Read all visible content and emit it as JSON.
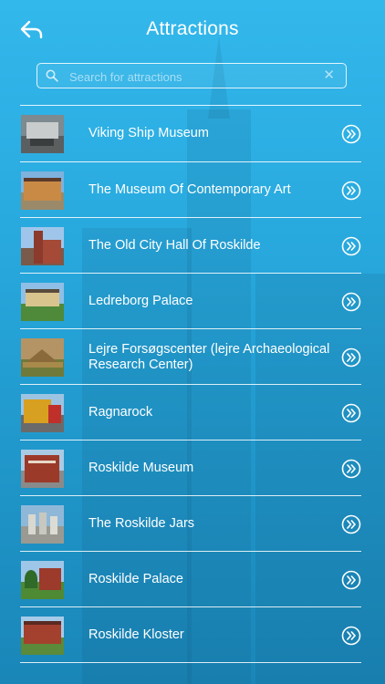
{
  "header": {
    "title": "Attractions",
    "back_icon": "back-arrow-icon"
  },
  "search": {
    "placeholder": "Search for attractions",
    "value": "",
    "clear_glyph": "✕"
  },
  "colors": {
    "background_top": "#33b8ec",
    "background_bottom": "#1a86b8",
    "text": "#ffffff"
  },
  "items": [
    {
      "label": "Viking Ship Museum"
    },
    {
      "label": "The Museum Of Contemporary Art"
    },
    {
      "label": "The Old City Hall Of Roskilde"
    },
    {
      "label": "Ledreborg Palace"
    },
    {
      "label": "Lejre Forsøgscenter (lejre Archaeological Research Center)"
    },
    {
      "label": "Ragnarock"
    },
    {
      "label": "Roskilde Museum"
    },
    {
      "label": "The Roskilde Jars"
    },
    {
      "label": "Roskilde Palace"
    },
    {
      "label": "Roskilde Kloster"
    }
  ]
}
